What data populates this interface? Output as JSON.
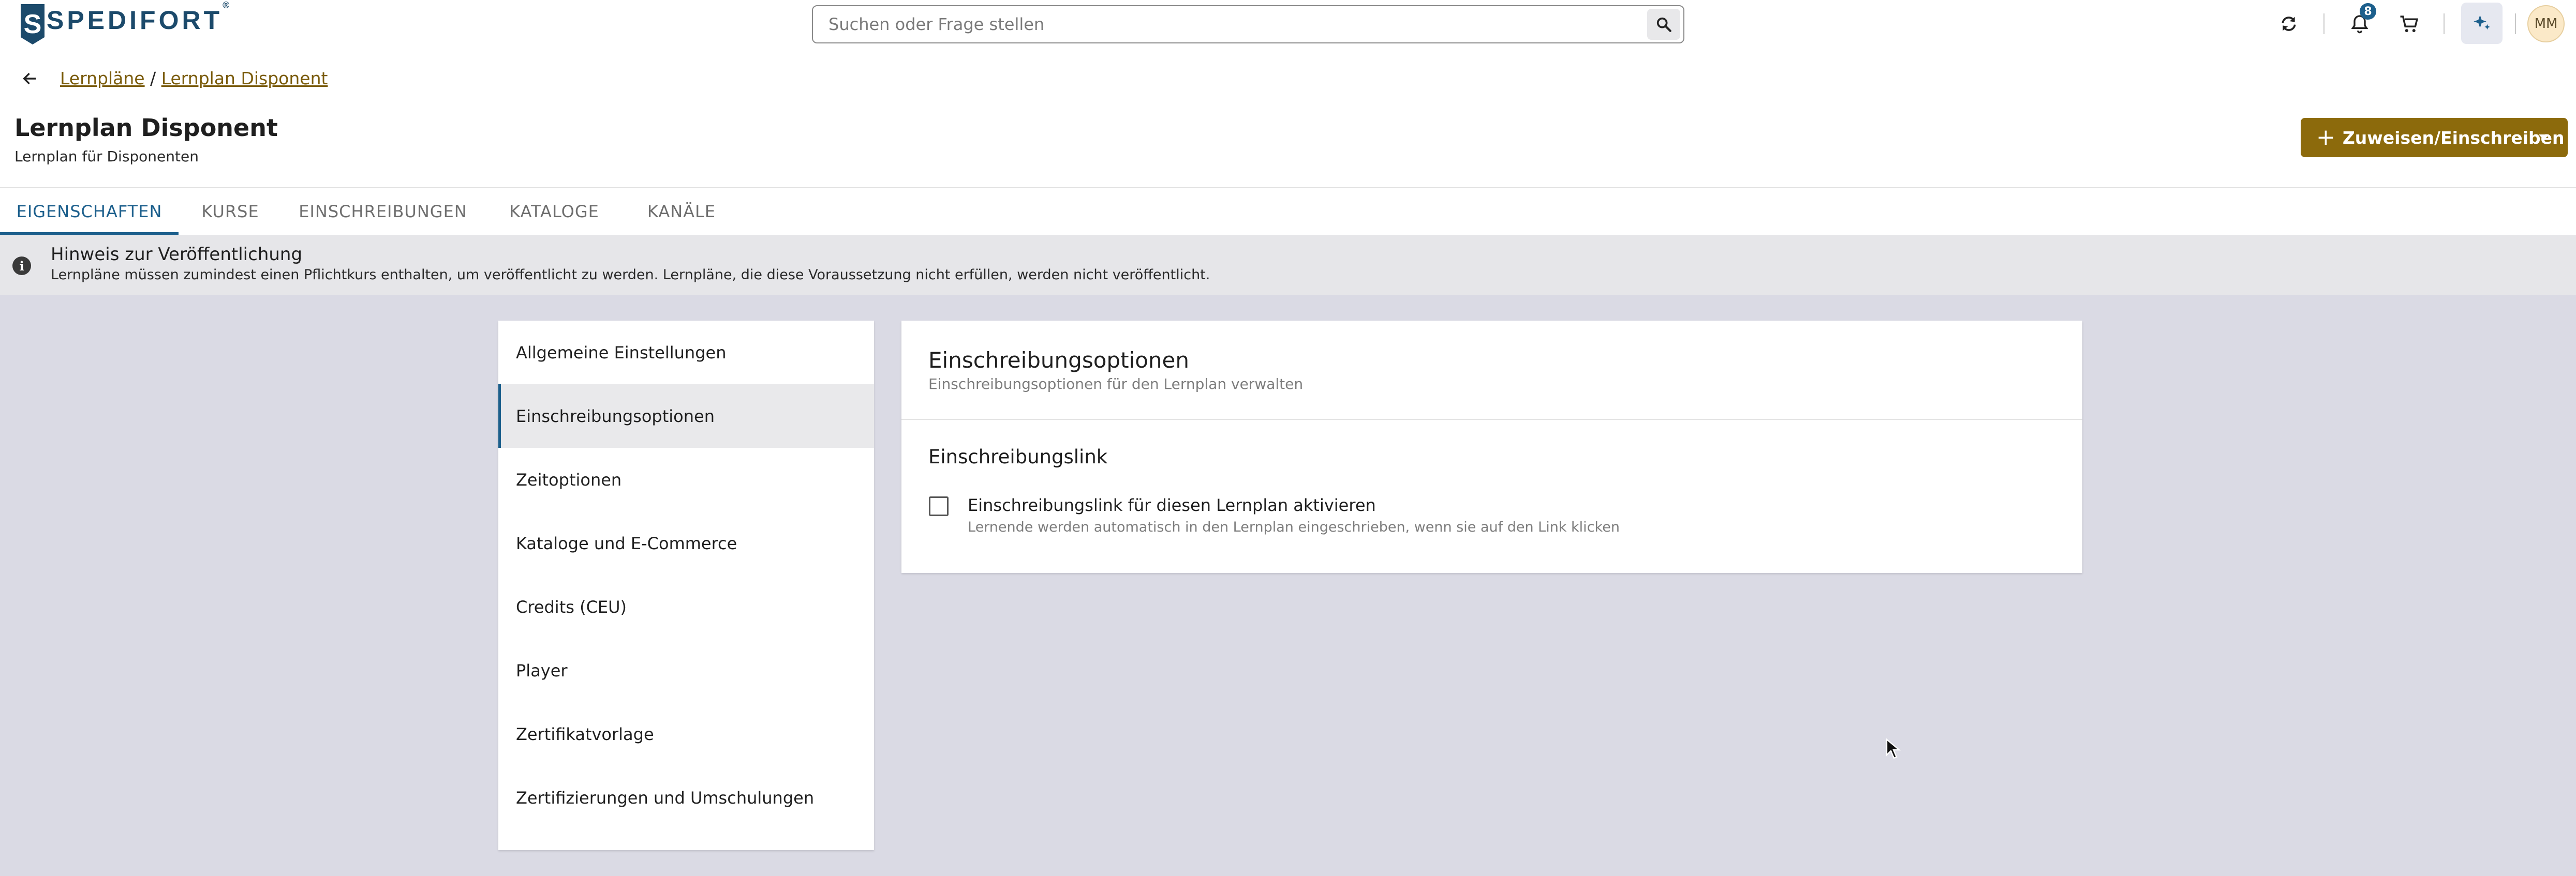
{
  "header": {
    "logo_text": "SPEDIFORT",
    "logo_mark": "S",
    "logo_reg": "®",
    "search_placeholder": "Suchen oder Frage stellen",
    "notification_count": "8",
    "avatar_initials": "MM",
    "icons": [
      "search-icon",
      "refresh-icon",
      "bell-icon",
      "cart-icon",
      "sparkle-icon"
    ]
  },
  "breadcrumb": {
    "items": [
      "Lernpläne",
      "Lernplan Disponent"
    ],
    "separator": "/"
  },
  "page": {
    "title": "Lernplan Disponent",
    "subtitle": "Lernplan für Disponenten",
    "assign_button": "Zuweisen/Einschreiben"
  },
  "tabs": [
    {
      "label": "EIGENSCHAFTEN",
      "active": true
    },
    {
      "label": "KURSE"
    },
    {
      "label": "EINSCHREIBUNGEN"
    },
    {
      "label": "KATALOGE"
    },
    {
      "label": "KANÄLE"
    }
  ],
  "notice": {
    "title": "Hinweis zur Veröffentlichung",
    "text": "Lernpläne müssen zumindest einen Pflichtkurs enthalten, um veröffentlicht zu werden. Lernpläne, die diese Voraussetzung nicht erfüllen, werden nicht veröffentlicht."
  },
  "settings_nav": [
    {
      "label": "Allgemeine Einstellungen"
    },
    {
      "label": "Einschreibungsoptionen",
      "active": true
    },
    {
      "label": "Zeitoptionen"
    },
    {
      "label": "Kataloge und E-Commerce"
    },
    {
      "label": "Credits (CEU)"
    },
    {
      "label": "Player"
    },
    {
      "label": "Zertifikatvorlage"
    },
    {
      "label": "Zertifizierungen und Umschulungen"
    }
  ],
  "panel": {
    "title": "Einschreibungsoptionen",
    "subtitle": "Einschreibungsoptionen für den Lernplan verwalten",
    "section_title": "Einschreibungslink",
    "checkbox_label": "Einschreibungslink für diesen Lernplan aktivieren",
    "checkbox_help": "Lernende werden automatisch in den Lernplan eingeschrieben, wenn sie auf den Link klicken",
    "checkbox_checked": false
  },
  "colors": {
    "brand_blue": "#1c5f8c",
    "logo_blue": "#1c4a6b",
    "accent_gold": "#8c6a0c",
    "background": "#dadae4"
  }
}
